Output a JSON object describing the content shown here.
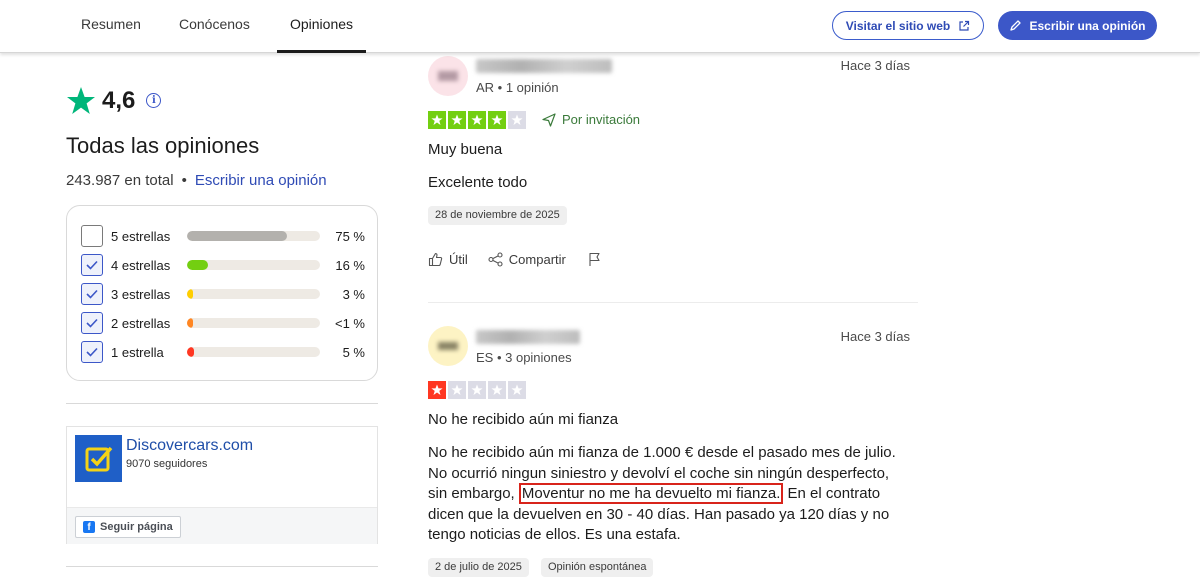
{
  "nav": {
    "tabs": [
      {
        "label": "Resumen"
      },
      {
        "label": "Conócenos"
      },
      {
        "label": "Opiniones"
      }
    ],
    "visit_button": "Visitar el sitio web",
    "write_button": "Escribir una opinión"
  },
  "summary": {
    "score": "4,6",
    "title": "Todas las opiniones",
    "total": "243.987 en total",
    "write_link": "Escribir una opinión",
    "distribution": [
      {
        "label": "5 estrellas",
        "percent_text": "75 %",
        "fill": 0.75,
        "color": "#b3b1ad",
        "checked": false
      },
      {
        "label": "4 estrellas",
        "percent_text": "16 %",
        "fill": 0.16,
        "color": "#73cf11",
        "checked": true
      },
      {
        "label": "3 estrellas",
        "percent_text": "3 %",
        "fill": 0.03,
        "color": "#ffce00",
        "checked": true
      },
      {
        "label": "2 estrellas",
        "percent_text": "<1 %",
        "fill": 0.01,
        "color": "#ff8622",
        "checked": true
      },
      {
        "label": "1 estrella",
        "percent_text": "5 %",
        "fill": 0.05,
        "color": "#ff3722",
        "checked": true
      }
    ]
  },
  "facebook_card": {
    "page_name": "Discovercars.com",
    "followers": "9070 seguidores",
    "follow_button": "Seguir página"
  },
  "reviews": [
    {
      "avatar_bg": "#fbe3e8",
      "meta": "AR • 1 opinión",
      "date": "Hace 3 días",
      "stars": 4,
      "star_color": "#73cf11",
      "invitation": "Por invitación",
      "title": "Muy buena",
      "body": "Excelente todo",
      "experience_date": "28 de noviembre de 2025",
      "actions": {
        "useful": "Útil",
        "share": "Compartir"
      }
    },
    {
      "avatar_bg": "#fdf3c4",
      "meta": "ES • 3 opiniones",
      "date": "Hace 3 días",
      "stars": 1,
      "star_color": "#ff3722",
      "title": "No he recibido aún mi fianza",
      "body_before": "No he recibido aún mi fianza de 1.000 € desde el pasado mes de julio. No ocurrió ningun siniestro y devolví el coche sin ningún desperfecto, sin embargo, ",
      "body_highlight": "Moventur no me ha devuelto mi fianza.",
      "body_after": " En el contrato dicen que la devuelven en 30 - 40 días. Han pasado ya 120 días y no tengo noticias de ellos. Es una estafa.",
      "experience_date": "2 de julio de 2025",
      "tag": "Opinión espontánea"
    }
  ]
}
